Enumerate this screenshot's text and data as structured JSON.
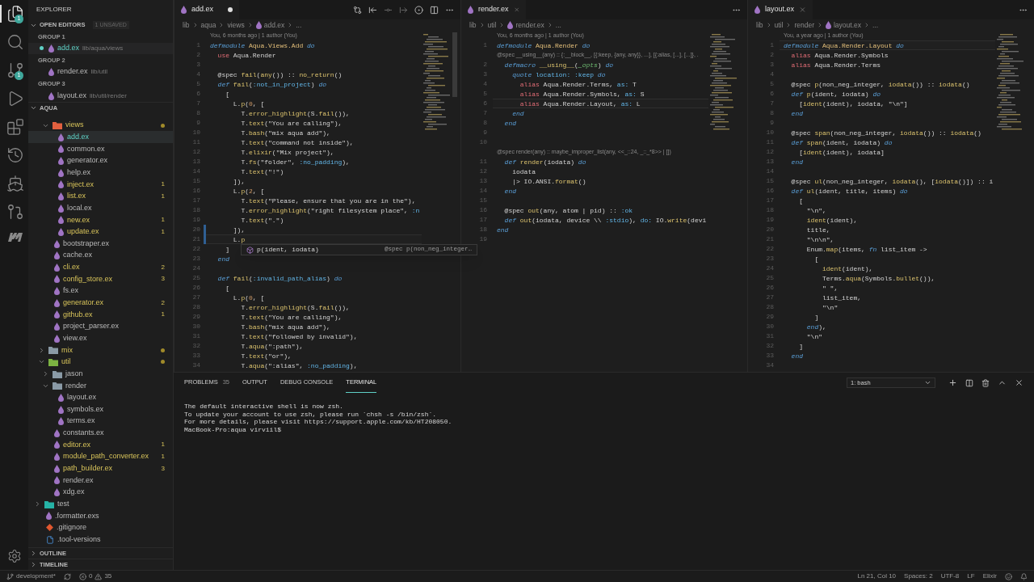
{
  "activity": [
    {
      "kind": "explorer",
      "selected": true,
      "badge": "1"
    },
    {
      "kind": "search",
      "selected": false
    },
    {
      "kind": "scm",
      "selected": false,
      "badge": "1"
    },
    {
      "kind": "run",
      "selected": false
    },
    {
      "kind": "extensions",
      "selected": false
    },
    {
      "kind": "history",
      "selected": false
    },
    {
      "kind": "docker",
      "selected": false
    },
    {
      "kind": "pull",
      "selected": false
    },
    {
      "kind": "logo",
      "selected": false
    }
  ],
  "sidebar": {
    "title": "EXPLORER",
    "open_editors": {
      "label": "OPEN EDITORS",
      "expanded": true,
      "badge": "1 UNSAVED",
      "groups": [
        {
          "label": "GROUP 1",
          "files": [
            {
              "name": "add.ex",
              "path": "lib/aqua/views",
              "dirty": true,
              "selected": true
            }
          ]
        },
        {
          "label": "GROUP 2",
          "files": [
            {
              "name": "render.ex",
              "path": "lib/util",
              "dirty": false,
              "selected": false
            }
          ]
        },
        {
          "label": "GROUP 3",
          "files": [
            {
              "name": "layout.ex",
              "path": "lib/util/render",
              "dirty": false,
              "selected": false
            }
          ]
        }
      ]
    },
    "project": {
      "label": "AQUA",
      "expanded": true
    },
    "tree": [
      {
        "children": [
          {
            "children": [
              {
                "kind": "folder",
                "name": "views",
                "expanded": true,
                "modified": true,
                "color": "#e2603f",
                "children": [
                  {
                    "kind": "elixir",
                    "name": "add.ex",
                    "selected": true
                  },
                  {
                    "kind": "elixir",
                    "name": "common.ex"
                  },
                  {
                    "kind": "elixir",
                    "name": "generator.ex"
                  },
                  {
                    "kind": "elixir",
                    "name": "help.ex"
                  },
                  {
                    "kind": "elixir",
                    "name": "inject.ex",
                    "modified": true,
                    "problems": "1"
                  },
                  {
                    "kind": "elixir",
                    "name": "list.ex",
                    "modified": true,
                    "problems": "1"
                  },
                  {
                    "kind": "elixir",
                    "name": "local.ex"
                  },
                  {
                    "kind": "elixir",
                    "name": "new.ex",
                    "modified": true,
                    "problems": "1"
                  },
                  {
                    "kind": "elixir",
                    "name": "update.ex",
                    "modified": true,
                    "problems": "1"
                  }
                ]
              },
              {
                "kind": "elixir",
                "name": "bootstraper.ex"
              },
              {
                "kind": "elixir",
                "name": "cache.ex"
              },
              {
                "kind": "elixir",
                "name": "cli.ex",
                "modified": true,
                "problems": "2"
              },
              {
                "kind": "elixir",
                "name": "config_store.ex",
                "modified": true,
                "problems": "3"
              },
              {
                "kind": "elixir",
                "name": "fs.ex"
              },
              {
                "kind": "elixir",
                "name": "generator.ex",
                "modified": true,
                "problems": "2"
              },
              {
                "kind": "elixir",
                "name": "github.ex",
                "modified": true,
                "problems": "1"
              },
              {
                "kind": "elixir",
                "name": "project_parser.ex"
              },
              {
                "kind": "elixir",
                "name": "view.ex"
              }
            ]
          },
          {
            "kind": "folder",
            "name": "mix",
            "expanded": false,
            "modified": true,
            "color": "#8a9aa6"
          },
          {
            "kind": "folder",
            "name": "util",
            "expanded": true,
            "modified": true,
            "color": "#7cb342",
            "children": [
              {
                "kind": "folder",
                "name": "jason",
                "expanded": false,
                "color": "#8a9aa6"
              },
              {
                "kind": "folder",
                "name": "render",
                "expanded": true,
                "color": "#8a9aa6",
                "children": [
                  {
                    "kind": "elixir",
                    "name": "layout.ex"
                  },
                  {
                    "kind": "elixir",
                    "name": "symbols.ex"
                  },
                  {
                    "kind": "elixir",
                    "name": "terms.ex"
                  }
                ]
              },
              {
                "kind": "elixir",
                "name": "constants.ex"
              },
              {
                "kind": "elixir",
                "name": "editor.ex",
                "modified": true,
                "problems": "1"
              },
              {
                "kind": "elixir",
                "name": "module_path_converter.ex",
                "modified": true,
                "problems": "1"
              },
              {
                "kind": "elixir",
                "name": "path_builder.ex",
                "modified": true,
                "problems": "3"
              },
              {
                "kind": "elixir",
                "name": "render.ex"
              },
              {
                "kind": "elixir",
                "name": "xdg.ex"
              }
            ]
          }
        ]
      },
      {
        "kind": "folder",
        "name": "test",
        "expanded": false,
        "color": "#26b3a6"
      },
      {
        "kind": "elixir",
        "name": ".formatter.exs"
      },
      {
        "kind": "git",
        "name": ".gitignore"
      },
      {
        "kind": "doc",
        "name": ".tool-versions"
      }
    ],
    "sections": [
      {
        "label": "OUTLINE",
        "expanded": false
      },
      {
        "label": "TIMELINE",
        "expanded": false
      }
    ]
  },
  "editors": [
    {
      "tab": {
        "name": "add.ex",
        "dirty": true
      },
      "actions": true,
      "breadcrumb": {
        "path": [
          "lib",
          "aqua",
          "views"
        ],
        "file": "add.ex",
        "tail": "..."
      },
      "suggest": {
        "label": "p(ident, iodata)",
        "detail": "@spec p(non_neg_integer…"
      },
      "lines": [
        {
          "lens": "You, 6 months ago | 1 author (You)",
          "n": "1",
          "tokens": [
            {
              "kind": "k",
              "text": "defmodule "
            },
            {
              "kind": "m",
              "text": "Aqua.Views.Add"
            },
            {
              "kind": "k",
              "text": " do"
            }
          ]
        },
        {
          "n": "2",
          "tokens": [
            {
              "kind": "a",
              "text": "  use"
            },
            {
              "kind": "p",
              "text": " Aqua.Render"
            }
          ]
        },
        {
          "n": "3"
        },
        {
          "n": "4",
          "tokens": [
            {
              "kind": "p",
              "text": "  @spec "
            },
            {
              "kind": "f",
              "text": "fail"
            },
            {
              "kind": "p",
              "text": "("
            },
            {
              "kind": "f",
              "text": "any"
            },
            {
              "kind": "p",
              "text": "()) :: "
            },
            {
              "kind": "f",
              "text": "no_return"
            },
            {
              "kind": "p",
              "text": "()"
            }
          ]
        },
        {
          "n": "5",
          "tokens": [
            {
              "kind": "k",
              "text": "  def "
            },
            {
              "kind": "f",
              "text": "fail"
            },
            {
              "kind": "p",
              "text": "("
            },
            {
              "kind": "o",
              "text": ":not_in_project"
            },
            {
              "kind": "p",
              "text": ") "
            },
            {
              "kind": "k",
              "text": "do"
            }
          ]
        },
        {
          "n": "6",
          "tokens": [
            {
              "kind": "p",
              "text": "    ["
            }
          ]
        },
        {
          "n": "7",
          "tokens": [
            {
              "kind": "p",
              "text": "      L."
            },
            {
              "kind": "f",
              "text": "p"
            },
            {
              "kind": "p",
              "text": "("
            },
            {
              "kind": "n",
              "text": "0"
            },
            {
              "kind": "p",
              "text": ", ["
            }
          ]
        },
        {
          "n": "8",
          "tokens": [
            {
              "kind": "p",
              "text": "        T."
            },
            {
              "kind": "f",
              "text": "error_highlight"
            },
            {
              "kind": "p",
              "text": "(S."
            },
            {
              "kind": "f",
              "text": "fail"
            },
            {
              "kind": "p",
              "text": "()),"
            }
          ]
        },
        {
          "n": "9",
          "tokens": [
            {
              "kind": "p",
              "text": "        T."
            },
            {
              "kind": "f",
              "text": "text"
            },
            {
              "kind": "p",
              "text": "(\"You are calling\"),"
            }
          ]
        },
        {
          "n": "10",
          "tokens": [
            {
              "kind": "p",
              "text": "        T."
            },
            {
              "kind": "f",
              "text": "bash"
            },
            {
              "kind": "p",
              "text": "(\"mix aqua add\"),"
            }
          ]
        },
        {
          "n": "11",
          "tokens": [
            {
              "kind": "p",
              "text": "        T."
            },
            {
              "kind": "f",
              "text": "text"
            },
            {
              "kind": "p",
              "text": "(\"command not inside\"),"
            }
          ]
        },
        {
          "n": "12",
          "tokens": [
            {
              "kind": "p",
              "text": "        T."
            },
            {
              "kind": "f",
              "text": "elixir"
            },
            {
              "kind": "p",
              "text": "(\"Mix project\"),"
            }
          ]
        },
        {
          "n": "13",
          "tokens": [
            {
              "kind": "p",
              "text": "        T."
            },
            {
              "kind": "f",
              "text": "fs"
            },
            {
              "kind": "p",
              "text": "(\"folder\", "
            },
            {
              "kind": "o",
              "text": ":no_padding"
            },
            {
              "kind": "p",
              "text": "),"
            }
          ]
        },
        {
          "n": "14",
          "tokens": [
            {
              "kind": "p",
              "text": "        T."
            },
            {
              "kind": "f",
              "text": "text"
            },
            {
              "kind": "p",
              "text": "(\"!\")"
            }
          ]
        },
        {
          "n": "15",
          "tokens": [
            {
              "kind": "p",
              "text": "      ]),"
            }
          ]
        },
        {
          "n": "16",
          "tokens": [
            {
              "kind": "p",
              "text": "      L."
            },
            {
              "kind": "f",
              "text": "p"
            },
            {
              "kind": "p",
              "text": "("
            },
            {
              "kind": "n",
              "text": "2"
            },
            {
              "kind": "p",
              "text": ", ["
            }
          ]
        },
        {
          "n": "17",
          "tokens": [
            {
              "kind": "p",
              "text": "        T."
            },
            {
              "kind": "f",
              "text": "text"
            },
            {
              "kind": "p",
              "text": "(\"Please, ensure that you are in the\"),"
            }
          ]
        },
        {
          "n": "18",
          "tokens": [
            {
              "kind": "p",
              "text": "        T."
            },
            {
              "kind": "f",
              "text": "error_highlight"
            },
            {
              "kind": "p",
              "text": "(\"right filesystem place\", "
            },
            {
              "kind": "o",
              "text": ":n"
            }
          ]
        },
        {
          "n": "19",
          "tokens": [
            {
              "kind": "p",
              "text": "        T."
            },
            {
              "kind": "f",
              "text": "text"
            },
            {
              "kind": "p",
              "text": "(\".\")"
            }
          ]
        },
        {
          "n": "20",
          "modified": true,
          "tokens": [
            {
              "kind": "p",
              "text": "      ]),"
            }
          ]
        },
        {
          "n": "21",
          "modified": true,
          "current": true,
          "tokens": [
            {
              "kind": "p",
              "text": "      L."
            },
            {
              "kind": "f",
              "text": "p"
            }
          ]
        },
        {
          "n": "22",
          "tokens": [
            {
              "kind": "p",
              "text": "    ]"
            }
          ]
        },
        {
          "n": "23",
          "tokens": [
            {
              "kind": "k",
              "text": "  end"
            }
          ]
        },
        {
          "n": "24"
        },
        {
          "n": "25",
          "tokens": [
            {
              "kind": "k",
              "text": "  def "
            },
            {
              "kind": "f",
              "text": "fail"
            },
            {
              "kind": "p",
              "text": "("
            },
            {
              "kind": "o",
              "text": ":invalid_path_alias"
            },
            {
              "kind": "p",
              "text": ") "
            },
            {
              "kind": "k",
              "text": "do"
            }
          ]
        },
        {
          "n": "26",
          "tokens": [
            {
              "kind": "p",
              "text": "    ["
            }
          ]
        },
        {
          "n": "27",
          "tokens": [
            {
              "kind": "p",
              "text": "      L."
            },
            {
              "kind": "f",
              "text": "p"
            },
            {
              "kind": "p",
              "text": "("
            },
            {
              "kind": "n",
              "text": "0"
            },
            {
              "kind": "p",
              "text": ", ["
            }
          ]
        },
        {
          "n": "28",
          "tokens": [
            {
              "kind": "p",
              "text": "        T."
            },
            {
              "kind": "f",
              "text": "error_highlight"
            },
            {
              "kind": "p",
              "text": "(S."
            },
            {
              "kind": "f",
              "text": "fail"
            },
            {
              "kind": "p",
              "text": "()),"
            }
          ]
        },
        {
          "n": "29",
          "tokens": [
            {
              "kind": "p",
              "text": "        T."
            },
            {
              "kind": "f",
              "text": "text"
            },
            {
              "kind": "p",
              "text": "(\"You are calling\"),"
            }
          ]
        },
        {
          "n": "30",
          "tokens": [
            {
              "kind": "p",
              "text": "        T."
            },
            {
              "kind": "f",
              "text": "bash"
            },
            {
              "kind": "p",
              "text": "(\"mix aqua add\"),"
            }
          ]
        },
        {
          "n": "31",
          "tokens": [
            {
              "kind": "p",
              "text": "        T."
            },
            {
              "kind": "f",
              "text": "text"
            },
            {
              "kind": "p",
              "text": "(\"followed by invalid\"),"
            }
          ]
        },
        {
          "n": "32",
          "tokens": [
            {
              "kind": "p",
              "text": "        T."
            },
            {
              "kind": "f",
              "text": "aqua"
            },
            {
              "kind": "p",
              "text": "(\":path\"),"
            }
          ]
        },
        {
          "n": "33",
          "tokens": [
            {
              "kind": "p",
              "text": "        T."
            },
            {
              "kind": "f",
              "text": "text"
            },
            {
              "kind": "p",
              "text": "(\"or\"),"
            }
          ]
        },
        {
          "n": "34",
          "tokens": [
            {
              "kind": "p",
              "text": "        T."
            },
            {
              "kind": "f",
              "text": "aqua"
            },
            {
              "kind": "p",
              "text": "(\":alias\", "
            },
            {
              "kind": "o",
              "text": ":no_padding"
            },
            {
              "kind": "p",
              "text": "),"
            }
          ]
        }
      ]
    },
    {
      "tab": {
        "name": "render.ex",
        "dirty": false
      },
      "actions": false,
      "breadcrumb": {
        "path": [
          "lib",
          "util"
        ],
        "file": "render.ex",
        "tail": "..."
      },
      "lines": [
        {
          "lens": "You, 6 months ago | 1 author (You)",
          "n": "1",
          "tokens": [
            {
              "kind": "k",
              "text": "defmodule "
            },
            {
              "kind": "m",
              "text": "Aqua.Render"
            },
            {
              "kind": "k",
              "text": " do"
            }
          ]
        },
        {
          "lens": "@spec __using__(any) :: {:__block__, [{:keep, {any, any}}, ...], [{:alias, [...], [...]}, .",
          "n": "2",
          "tokens": [
            {
              "kind": "k",
              "text": "  defmacro "
            },
            {
              "kind": "f",
              "text": "__using__"
            },
            {
              "kind": "p",
              "text": "("
            },
            {
              "kind": "g",
              "text": "_opts"
            },
            {
              "kind": "p",
              "text": ") "
            },
            {
              "kind": "k",
              "text": "do"
            }
          ]
        },
        {
          "n": "3",
          "tokens": [
            {
              "kind": "k",
              "text": "    quote "
            },
            {
              "kind": "o",
              "text": "location: :keep "
            },
            {
              "kind": "k",
              "text": "do"
            }
          ]
        },
        {
          "n": "4",
          "tokens": [
            {
              "kind": "a",
              "text": "      alias"
            },
            {
              "kind": "p",
              "text": " Aqua.Render.Terms, "
            },
            {
              "kind": "o",
              "text": "as:"
            },
            {
              "kind": "p",
              "text": " T"
            }
          ]
        },
        {
          "n": "5",
          "tokens": [
            {
              "kind": "a",
              "text": "      alias"
            },
            {
              "kind": "p",
              "text": " Aqua.Render.Symbols, "
            },
            {
              "kind": "o",
              "text": "as:"
            },
            {
              "kind": "p",
              "text": " S"
            }
          ]
        },
        {
          "n": "6",
          "current": true,
          "tokens": [
            {
              "kind": "a",
              "text": "      alias"
            },
            {
              "kind": "p",
              "text": " Aqua.Render.Layout, "
            },
            {
              "kind": "o",
              "text": "as:"
            },
            {
              "kind": "p",
              "text": " L"
            }
          ]
        },
        {
          "n": "7",
          "tokens": [
            {
              "kind": "k",
              "text": "    end"
            }
          ]
        },
        {
          "n": "8",
          "tokens": [
            {
              "kind": "k",
              "text": "  end"
            }
          ]
        },
        {
          "n": "9"
        },
        {
          "n": "10"
        },
        {
          "lens": "@spec render(any) :: maybe_improper_list(any, <<_::24, _::_*8>> | [])",
          "n": "11",
          "tokens": [
            {
              "kind": "k",
              "text": "  def "
            },
            {
              "kind": "f",
              "text": "render"
            },
            {
              "kind": "p",
              "text": "(iodata) "
            },
            {
              "kind": "k",
              "text": "do"
            }
          ]
        },
        {
          "n": "12",
          "tokens": [
            {
              "kind": "p",
              "text": "    iodata"
            }
          ]
        },
        {
          "n": "13",
          "tokens": [
            {
              "kind": "p",
              "text": "    |> IO.ANSI."
            },
            {
              "kind": "f",
              "text": "format"
            },
            {
              "kind": "p",
              "text": "()"
            }
          ]
        },
        {
          "n": "14",
          "tokens": [
            {
              "kind": "k",
              "text": "  end"
            }
          ]
        },
        {
          "n": "15"
        },
        {
          "n": "16",
          "tokens": [
            {
              "kind": "p",
              "text": "  @spec "
            },
            {
              "kind": "f",
              "text": "out"
            },
            {
              "kind": "p",
              "text": "(any, atom | pid) :: "
            },
            {
              "kind": "o",
              "text": ":ok"
            }
          ]
        },
        {
          "n": "17",
          "tokens": [
            {
              "kind": "k",
              "text": "  def "
            },
            {
              "kind": "f",
              "text": "out"
            },
            {
              "kind": "p",
              "text": "(iodata, device \\\\ "
            },
            {
              "kind": "o",
              "text": ":stdio"
            },
            {
              "kind": "p",
              "text": "), "
            },
            {
              "kind": "o",
              "text": "do:"
            },
            {
              "kind": "p",
              "text": " IO."
            },
            {
              "kind": "f",
              "text": "write"
            },
            {
              "kind": "p",
              "text": "(devi"
            }
          ]
        },
        {
          "n": "18",
          "tokens": [
            {
              "kind": "k",
              "text": "end"
            }
          ]
        },
        {
          "n": "19"
        }
      ]
    },
    {
      "tab": {
        "name": "layout.ex",
        "dirty": false
      },
      "actions": false,
      "breadcrumb": {
        "path": [
          "lib",
          "util",
          "render"
        ],
        "file": "layout.ex",
        "tail": "..."
      },
      "lines": [
        {
          "lens": "You, a year ago | 1 author (You)",
          "n": "1",
          "current": true,
          "tokens": [
            {
              "kind": "k",
              "text": "defmodule "
            },
            {
              "kind": "m",
              "text": "Aqua.Render.Layout"
            },
            {
              "kind": "k",
              "text": " do"
            }
          ]
        },
        {
          "n": "2",
          "tokens": [
            {
              "kind": "a",
              "text": "  alias"
            },
            {
              "kind": "p",
              "text": " Aqua.Render.Symbols"
            }
          ]
        },
        {
          "n": "3",
          "tokens": [
            {
              "kind": "a",
              "text": "  alias"
            },
            {
              "kind": "p",
              "text": " Aqua.Render.Terms"
            }
          ]
        },
        {
          "n": "4"
        },
        {
          "n": "5",
          "tokens": [
            {
              "kind": "p",
              "text": "  @spec "
            },
            {
              "kind": "f",
              "text": "p"
            },
            {
              "kind": "p",
              "text": "(non_neg_integer, "
            },
            {
              "kind": "f",
              "text": "iodata"
            },
            {
              "kind": "p",
              "text": "()) :: "
            },
            {
              "kind": "f",
              "text": "iodata"
            },
            {
              "kind": "p",
              "text": "()"
            }
          ]
        },
        {
          "n": "6",
          "tokens": [
            {
              "kind": "k",
              "text": "  def "
            },
            {
              "kind": "f",
              "text": "p"
            },
            {
              "kind": "p",
              "text": "(ident, iodata) "
            },
            {
              "kind": "k",
              "text": "do"
            }
          ]
        },
        {
          "n": "7",
          "tokens": [
            {
              "kind": "p",
              "text": "    ["
            },
            {
              "kind": "f",
              "text": "ident"
            },
            {
              "kind": "p",
              "text": "(ident), iodata, \"\\n\"]"
            }
          ]
        },
        {
          "n": "8",
          "tokens": [
            {
              "kind": "k",
              "text": "  end"
            }
          ]
        },
        {
          "n": "9"
        },
        {
          "n": "10",
          "tokens": [
            {
              "kind": "p",
              "text": "  @spec "
            },
            {
              "kind": "f",
              "text": "span"
            },
            {
              "kind": "p",
              "text": "(non_neg_integer, "
            },
            {
              "kind": "f",
              "text": "iodata"
            },
            {
              "kind": "p",
              "text": "()) :: "
            },
            {
              "kind": "f",
              "text": "iodata"
            },
            {
              "kind": "p",
              "text": "()"
            }
          ]
        },
        {
          "n": "11",
          "tokens": [
            {
              "kind": "k",
              "text": "  def "
            },
            {
              "kind": "f",
              "text": "span"
            },
            {
              "kind": "p",
              "text": "(ident, iodata) "
            },
            {
              "kind": "k",
              "text": "do"
            }
          ]
        },
        {
          "n": "12",
          "tokens": [
            {
              "kind": "p",
              "text": "    ["
            },
            {
              "kind": "f",
              "text": "ident"
            },
            {
              "kind": "p",
              "text": "(ident), iodata]"
            }
          ]
        },
        {
          "n": "13",
          "tokens": [
            {
              "kind": "k",
              "text": "  end"
            }
          ]
        },
        {
          "n": "14"
        },
        {
          "n": "15",
          "tokens": [
            {
              "kind": "p",
              "text": "  @spec "
            },
            {
              "kind": "f",
              "text": "ul"
            },
            {
              "kind": "p",
              "text": "(non_neg_integer, "
            },
            {
              "kind": "f",
              "text": "iodata"
            },
            {
              "kind": "p",
              "text": "(), ["
            },
            {
              "kind": "f",
              "text": "iodata"
            },
            {
              "kind": "p",
              "text": "()]) :: i"
            }
          ]
        },
        {
          "n": "16",
          "tokens": [
            {
              "kind": "k",
              "text": "  def "
            },
            {
              "kind": "f",
              "text": "ul"
            },
            {
              "kind": "p",
              "text": "(ident, title, items) "
            },
            {
              "kind": "k",
              "text": "do"
            }
          ]
        },
        {
          "n": "17",
          "tokens": [
            {
              "kind": "p",
              "text": "    ["
            }
          ]
        },
        {
          "n": "18",
          "tokens": [
            {
              "kind": "p",
              "text": "      \"\\n\","
            }
          ]
        },
        {
          "n": "19",
          "tokens": [
            {
              "kind": "f",
              "text": "      ident"
            },
            {
              "kind": "p",
              "text": "(ident),"
            }
          ]
        },
        {
          "n": "20",
          "tokens": [
            {
              "kind": "p",
              "text": "      title,"
            }
          ]
        },
        {
          "n": "21",
          "tokens": [
            {
              "kind": "p",
              "text": "      \"\\n\\n\","
            }
          ]
        },
        {
          "n": "22",
          "tokens": [
            {
              "kind": "p",
              "text": "      Enum."
            },
            {
              "kind": "f",
              "text": "map"
            },
            {
              "kind": "p",
              "text": "(items, "
            },
            {
              "kind": "k",
              "text": "fn"
            },
            {
              "kind": "p",
              "text": " list_item ->"
            }
          ]
        },
        {
          "n": "23",
          "tokens": [
            {
              "kind": "p",
              "text": "        ["
            }
          ]
        },
        {
          "n": "24",
          "tokens": [
            {
              "kind": "f",
              "text": "          ident"
            },
            {
              "kind": "p",
              "text": "(ident),"
            }
          ]
        },
        {
          "n": "25",
          "tokens": [
            {
              "kind": "p",
              "text": "          Terms."
            },
            {
              "kind": "f",
              "text": "aqua"
            },
            {
              "kind": "p",
              "text": "(Symbols."
            },
            {
              "kind": "f",
              "text": "bullet"
            },
            {
              "kind": "p",
              "text": "()),"
            }
          ]
        },
        {
          "n": "26",
          "tokens": [
            {
              "kind": "p",
              "text": "          \" \","
            }
          ]
        },
        {
          "n": "27",
          "tokens": [
            {
              "kind": "p",
              "text": "          list_item,"
            }
          ]
        },
        {
          "n": "28",
          "tokens": [
            {
              "kind": "p",
              "text": "          \"\\n\""
            }
          ]
        },
        {
          "n": "29",
          "tokens": [
            {
              "kind": "p",
              "text": "        ]"
            }
          ]
        },
        {
          "n": "30",
          "tokens": [
            {
              "kind": "k",
              "text": "      end"
            },
            {
              "kind": "p",
              "text": "),"
            }
          ]
        },
        {
          "n": "31",
          "tokens": [
            {
              "kind": "p",
              "text": "      \"\\n\""
            }
          ]
        },
        {
          "n": "32",
          "tokens": [
            {
              "kind": "p",
              "text": "    ]"
            }
          ]
        },
        {
          "n": "33",
          "tokens": [
            {
              "kind": "k",
              "text": "  end"
            }
          ]
        },
        {
          "n": "34"
        }
      ]
    }
  ],
  "panel": {
    "tabs": [
      {
        "label": "PROBLEMS",
        "count": "35",
        "selected": false
      },
      {
        "label": "OUTPUT",
        "selected": false
      },
      {
        "label": "DEBUG CONSOLE",
        "selected": false
      },
      {
        "label": "TERMINAL",
        "selected": true
      }
    ],
    "terminal_select": "1: bash",
    "terminal": [
      "The default interactive shell is now zsh.",
      "To update your account to use zsh, please run `chsh -s /bin/zsh`.",
      "For more details, please visit https://support.apple.com/kb/HT208050.",
      "MacBook-Pro:aqua virviil$"
    ]
  },
  "status_bar": {
    "branch": "development*",
    "errors": "0",
    "warnings": "35",
    "items": [
      "Ln 21, Col 10",
      "Spaces: 2",
      "UTF-8",
      "LF",
      "Elixir"
    ]
  }
}
